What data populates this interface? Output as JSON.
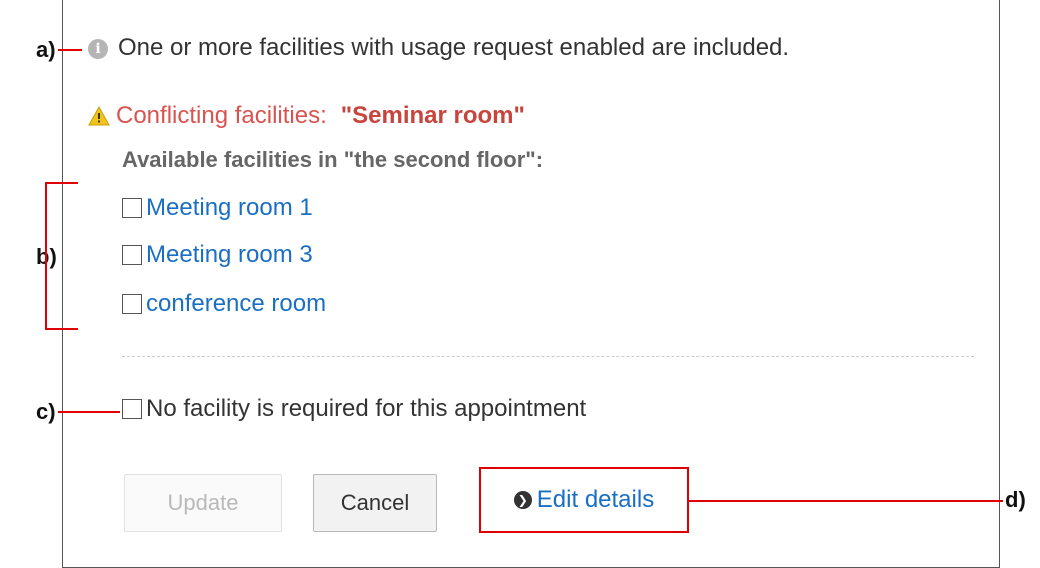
{
  "annotations": {
    "a": "a)",
    "b": "b)",
    "c": "c)",
    "d": "d)"
  },
  "info": {
    "icon": "info-icon",
    "text": "One or more facilities with usage request enabled are included."
  },
  "conflict": {
    "icon": "warning-icon",
    "label": "Conflicting facilities:",
    "value": "\"Seminar room\""
  },
  "available": {
    "heading": "Available facilities in \"the second floor\":",
    "facilities": [
      {
        "label": "Meeting room 1",
        "checked": false
      },
      {
        "label": "Meeting room 3",
        "checked": false
      },
      {
        "label": "conference room",
        "checked": false
      }
    ]
  },
  "no_facility": {
    "label": "No facility is required for this appointment",
    "checked": false
  },
  "buttons": {
    "update": "Update",
    "cancel": "Cancel"
  },
  "edit_details": {
    "icon": "chevron-right-circle-icon",
    "label": "Edit details"
  },
  "colors": {
    "annotation": "#e00000",
    "link": "#1a6fc4",
    "conflict": "#d9534f"
  }
}
